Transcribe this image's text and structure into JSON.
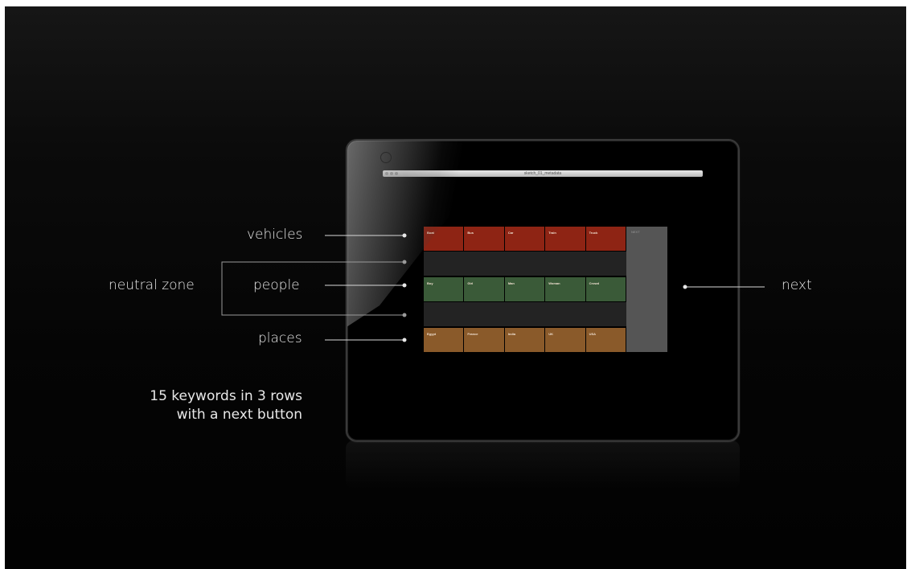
{
  "annotations": {
    "vehicles": "vehicles",
    "people": "people",
    "places": "places",
    "neutral_zone": "neutral zone",
    "next": "next",
    "caption_line1": "15 keywords in 3 rows",
    "caption_line2": "with a next button"
  },
  "window": {
    "title": "sketch_01_metadata"
  },
  "rows": {
    "vehicles": {
      "color": "#8e2414",
      "items": [
        "Boat",
        "Bus",
        "Car",
        "Train",
        "Truck"
      ]
    },
    "people": {
      "color": "#3a5a38",
      "items": [
        "Boy",
        "Girl",
        "Man",
        "Woman",
        "Crowd"
      ]
    },
    "places": {
      "color": "#8a5a2a",
      "items": [
        "Egypt",
        "France",
        "India",
        "UK",
        "USA"
      ]
    }
  },
  "next_button": {
    "label": "NEXT",
    "color": "#555555"
  }
}
